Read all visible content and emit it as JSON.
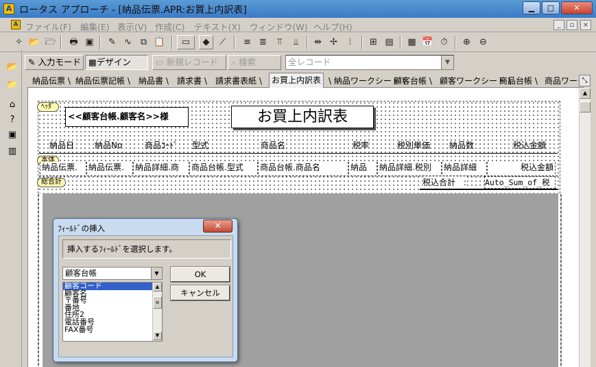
{
  "window": {
    "title": "ロータス アプローチ - [納品伝票.APR:お買上内訳表]",
    "controls": [
      "▁",
      "□",
      "✕"
    ]
  },
  "menu": {
    "items": [
      "ファイル(F)",
      "編集(E)",
      "表示(V)",
      "作成(C)",
      "テキスト(X)",
      "ウィンドウ(W)",
      "ヘルプ(H)"
    ],
    "mdi_controls": [
      "_",
      "▫",
      "×"
    ]
  },
  "modebar": {
    "input_mode": "入力モード",
    "design": "デザイン",
    "new_record": "新規レコード",
    "search": "検索",
    "record_filter": "全レコード"
  },
  "tabs": [
    "納品伝票",
    "納品伝票記帳",
    "納品書",
    "請求書",
    "請求書表紙",
    "お買上内訳表",
    "納品ワークシート",
    "顧客台帳",
    "顧客ワークシート",
    "商品台帳",
    "商品ワーク"
  ],
  "active_tab": 5,
  "report": {
    "header_tag": "ﾍｯﾀﾞ",
    "header_field": "<<顧客台帳.顧客名>>様",
    "title": "お買上内訳表",
    "columns": [
      "納品日",
      "納品No",
      "商品ｺｰﾄﾞ",
      "型式",
      "商品名",
      "税率",
      "税別単価",
      "納品数",
      "税込金額"
    ],
    "body_tag": "本体",
    "body_fields": [
      "納品伝票.",
      "納品伝票.",
      "納品詳細.商",
      "商品台帳.型式",
      "商品台帳.商品名",
      "納品",
      "納品詳細.税別",
      "納品詳細",
      "税込金額"
    ],
    "summary_tag": "総合計",
    "summary_label": "税込合計　:",
    "summary_field": "Auto_Sum_of_税"
  },
  "dialog": {
    "title": "ﾌｨｰﾙﾄﾞの挿入",
    "close": "✕",
    "prompt": "挿入するﾌｨｰﾙﾄﾞを選択します。",
    "database": "顧客台帳",
    "fields": [
      "顧客コード",
      "顧客名",
      "〒番号",
      "番地",
      "住所2",
      "電話番号",
      "FAX番号"
    ],
    "selected_index": 0,
    "ok": "OK",
    "cancel": "キャンセル"
  }
}
